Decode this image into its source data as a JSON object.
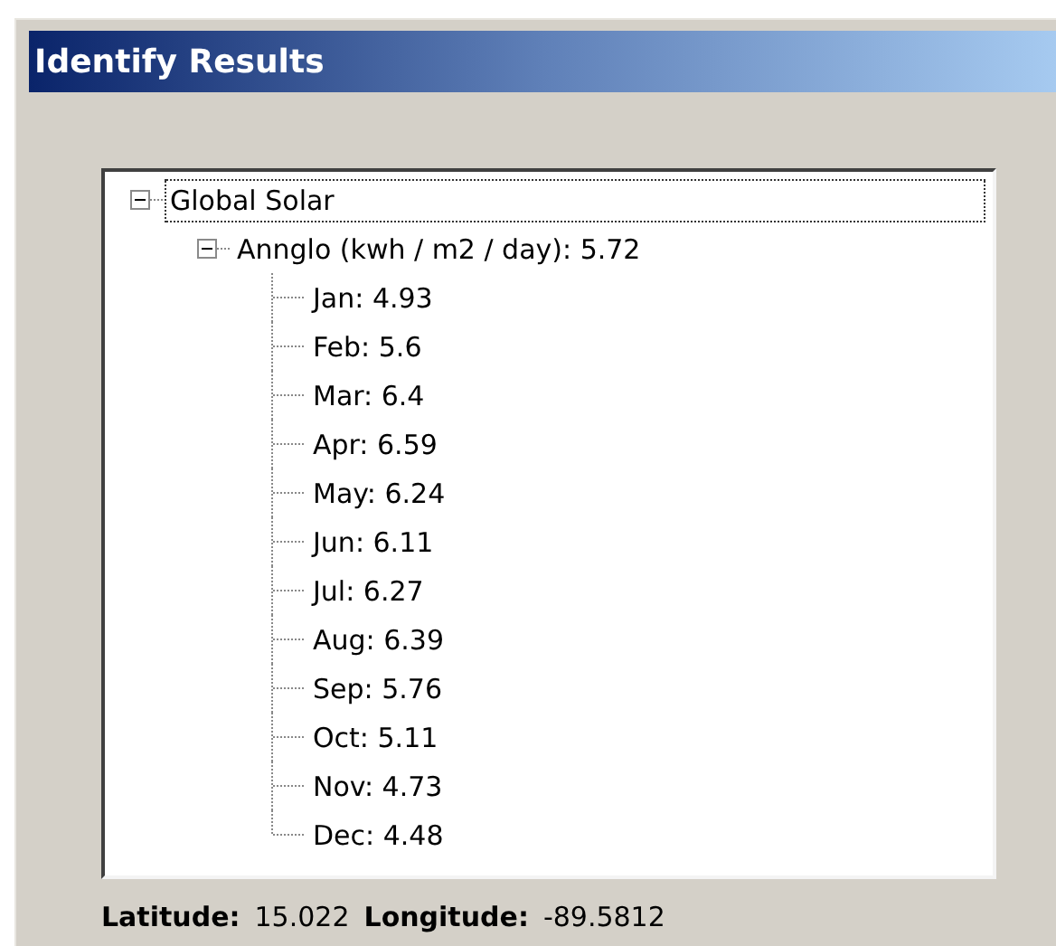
{
  "window": {
    "title": "Identify Results"
  },
  "tree": [
    {
      "label": "Global Solar",
      "selected": true,
      "expanded": true,
      "children": [
        {
          "label": "Annglo (kwh / m2 / day): 5.72",
          "selected": false,
          "expanded": true,
          "children": [
            {
              "label": "Jan: 4.93",
              "selected": false
            },
            {
              "label": "Feb: 5.6",
              "selected": false
            },
            {
              "label": "Mar: 6.4",
              "selected": false
            },
            {
              "label": "Apr: 6.59",
              "selected": false
            },
            {
              "label": "May: 6.24",
              "selected": false
            },
            {
              "label": "Jun: 6.11",
              "selected": false
            },
            {
              "label": "Jul: 6.27",
              "selected": false
            },
            {
              "label": "Aug: 6.39",
              "selected": false
            },
            {
              "label": "Sep: 5.76",
              "selected": false
            },
            {
              "label": "Oct: 5.11",
              "selected": false
            },
            {
              "label": "Nov: 4.73",
              "selected": false
            },
            {
              "label": "Dec: 4.48",
              "selected": false
            }
          ]
        }
      ]
    }
  ],
  "status": [
    {
      "label": "Latitude:",
      "value": "15.022"
    },
    {
      "label": "Longitude:",
      "value": "-89.5812"
    }
  ]
}
